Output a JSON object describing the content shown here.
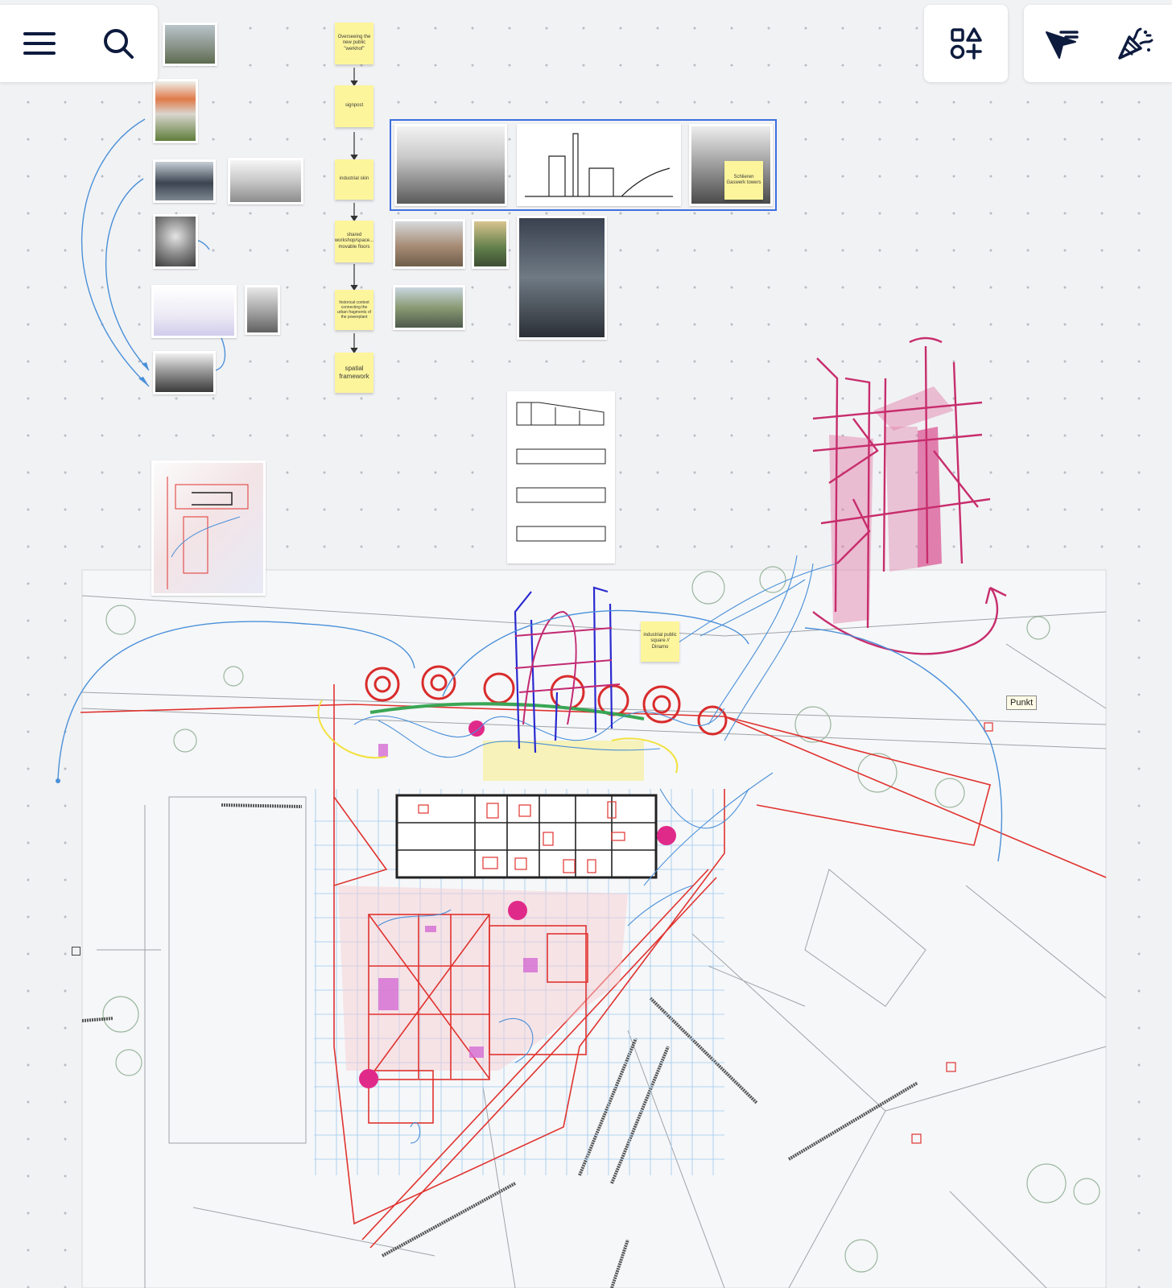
{
  "toolbar": {
    "menu_icon": "hamburger-menu-icon",
    "search_icon": "search-icon",
    "shapes_icon": "shapes-plus-icon",
    "collaborate_icon": "cursor-lines-icon",
    "celebrate_icon": "party-popper-icon"
  },
  "flow_stickies": [
    "Overseeing the new public \"werkhof\"",
    "signpost",
    "industrial skin",
    "shared workshop/space... movable floors",
    "historical context connecting the urban fragments of the powerplant",
    "spatial framework"
  ],
  "sticky_towers": "Schlieren Gaswerk towers",
  "sticky_square": "industrial public square // Dinamo",
  "tooltip_punkt": "Punkt",
  "colors": {
    "canvas": "#f1f2f4",
    "selection": "#3d6fe0",
    "sticky": "#fdf59b",
    "sketch_red": "#e0332f",
    "sketch_magenta": "#cc2f6a",
    "sketch_blue": "#4a90d9",
    "navy_icon": "#0d1b3e"
  }
}
